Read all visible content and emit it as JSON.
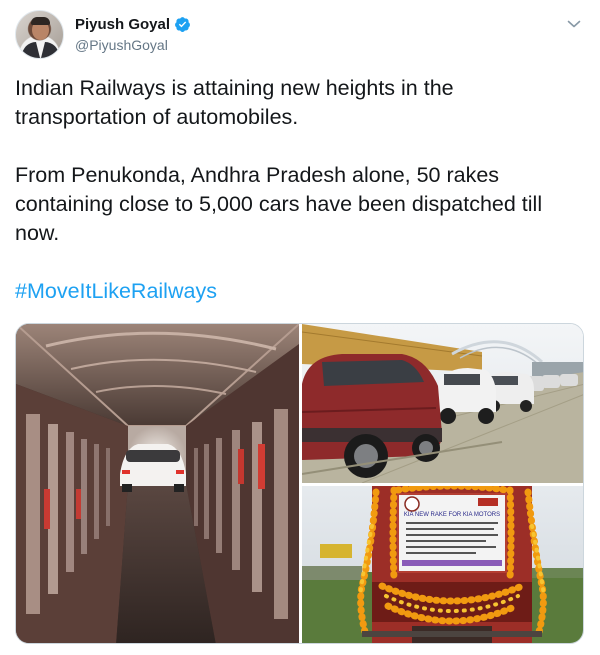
{
  "author": {
    "display_name": "Piyush Goyal",
    "handle": "@PiyushGoyal",
    "verified": true
  },
  "tweet": {
    "paragraph_1": "Indian Railways is attaining new heights in the transportation of automobiles.",
    "paragraph_2": "From Penukonda, Andhra Pradesh alone, 50 rakes containing close to 5,000 cars have been dispatched till now.",
    "hashtag": "#MoveItLikeRailways"
  },
  "media": {
    "photo_count": 3,
    "banner_title": "KIA NEW RAKE FOR KIA MOTORS"
  },
  "colors": {
    "link": "#1da1f2",
    "verified": "#1da1f2",
    "secondary_text": "#657786"
  }
}
